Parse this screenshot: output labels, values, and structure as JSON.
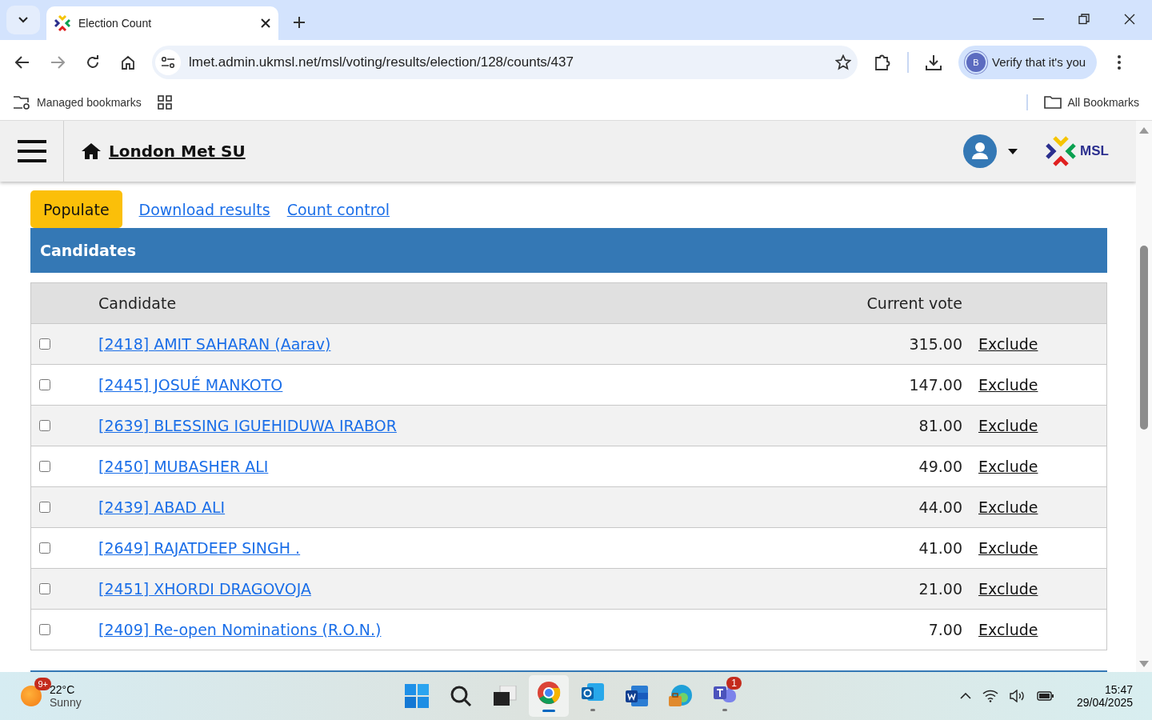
{
  "browser": {
    "tab_title": "Election Count",
    "url": "lmet.admin.ukmsl.net/msl/voting/results/election/128/counts/437",
    "profile_initial": "B",
    "verify_label": "Verify that it's you",
    "bookmarks_left": "Managed bookmarks",
    "bookmarks_right": "All Bookmarks"
  },
  "site": {
    "title": "London Met SU",
    "logo_text": "MSL"
  },
  "actions": {
    "primary": "Populate",
    "links": [
      "Download results",
      "Count control"
    ]
  },
  "table": {
    "title": "Candidates",
    "columns": [
      "Candidate",
      "Current vote"
    ],
    "rows": [
      {
        "checked": false,
        "name": "[2418] AMIT SAHARAN (Aarav)",
        "vote": "315.00",
        "action": "Exclude"
      },
      {
        "checked": false,
        "name": "[2445] JOSUÉ MANKOTO",
        "vote": "147.00",
        "action": "Exclude"
      },
      {
        "checked": false,
        "name": "[2639] BLESSING IGUEHIDUWA IRABOR",
        "vote": "81.00",
        "action": "Exclude"
      },
      {
        "checked": false,
        "name": "[2450] MUBASHER ALI",
        "vote": "49.00",
        "action": "Exclude"
      },
      {
        "checked": false,
        "name": "[2439] ABAD ALI",
        "vote": "44.00",
        "action": "Exclude"
      },
      {
        "checked": false,
        "name": "[2649] RAJATDEEP SINGH .",
        "vote": "41.00",
        "action": "Exclude"
      },
      {
        "checked": false,
        "name": "[2451] XHORDI DRAGOVOJA",
        "vote": "21.00",
        "action": "Exclude"
      },
      {
        "checked": false,
        "name": "[2409] Re-open Nominations (R.O.N.)",
        "vote": "7.00",
        "action": "Exclude"
      }
    ]
  },
  "taskbar": {
    "weather_badge": "9+",
    "temperature": "22°C",
    "condition": "Sunny",
    "apps": [
      {
        "kind": "start",
        "open": false,
        "selected": false
      },
      {
        "kind": "search",
        "open": false,
        "selected": false
      },
      {
        "kind": "taskview",
        "open": false,
        "selected": false
      },
      {
        "kind": "chrome",
        "open": true,
        "selected": true
      },
      {
        "kind": "outlook",
        "open": true,
        "selected": false
      },
      {
        "kind": "word",
        "open": false,
        "selected": false
      },
      {
        "kind": "edge",
        "open": false,
        "selected": false
      },
      {
        "kind": "teams",
        "open": true,
        "selected": false,
        "badge": "1"
      }
    ],
    "time": "15:47",
    "date": "29/04/2025"
  }
}
